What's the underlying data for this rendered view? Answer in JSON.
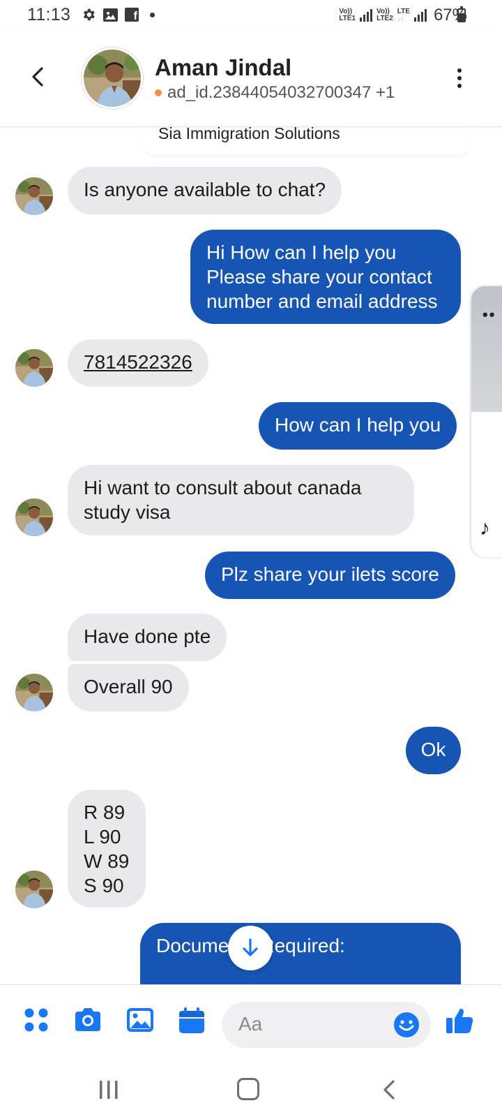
{
  "status_bar": {
    "time": "11:13",
    "network1": [
      "Vo))",
      "LTE1"
    ],
    "network2": [
      "Vo))",
      "LTE2"
    ],
    "network_lte": "LTE",
    "battery": "67%"
  },
  "header": {
    "name": "Aman Jindal",
    "subtitle": "ad_id.23844054032700347 +1",
    "status_dot_color": "#f7913d"
  },
  "pinned": {
    "text": "Sia Immigration Solutions"
  },
  "messages": [
    {
      "side": "in",
      "text": "Is anyone available to chat?"
    },
    {
      "side": "out",
      "lines": [
        "Hi How can I help you",
        "Please share your contact",
        "number and email address"
      ]
    },
    {
      "side": "in",
      "text": "7814522326",
      "is_phone_link": true
    },
    {
      "side": "out",
      "text": "How can I help you"
    },
    {
      "side": "in",
      "lines": [
        "Hi want to consult about canada",
        "study visa"
      ]
    },
    {
      "side": "out",
      "text": "Plz share your ilets score"
    },
    {
      "side": "in",
      "text": "Have done pte"
    },
    {
      "side": "in",
      "text": "Overall 90"
    },
    {
      "side": "out",
      "text": "Ok"
    },
    {
      "side": "in",
      "lines": [
        "R 89",
        "L 90",
        "W 89",
        "S 90"
      ]
    },
    {
      "side": "out",
      "text": "Documents Required:"
    }
  ],
  "composer": {
    "placeholder": "Aa",
    "icons": [
      "menu-grid-icon",
      "camera-icon",
      "gallery-icon",
      "calendar-icon",
      "emoji-icon",
      "thumbs-up-icon"
    ]
  },
  "colors": {
    "outgoing_bubble": "#1655b4",
    "incoming_bubble": "#e9e9eb",
    "accent": "#1877f2"
  }
}
